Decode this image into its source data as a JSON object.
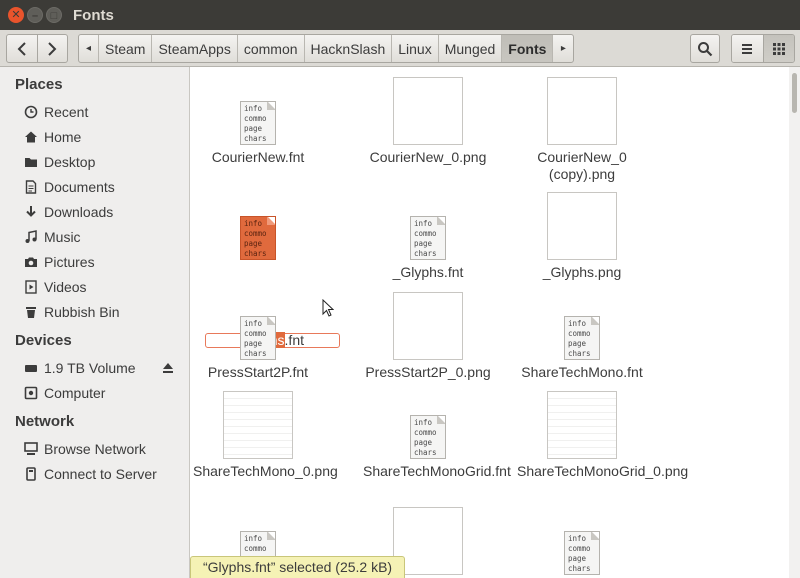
{
  "window": {
    "title": "Fonts"
  },
  "breadcrumbs": [
    {
      "label": "Steam"
    },
    {
      "label": "SteamApps"
    },
    {
      "label": "common"
    },
    {
      "label": "HacknSlash"
    },
    {
      "label": "Linux"
    },
    {
      "label": "Munged"
    },
    {
      "label": "Fonts",
      "active": true
    }
  ],
  "sidebar": {
    "places_heading": "Places",
    "places": [
      {
        "label": "Recent",
        "icon": "clock-icon"
      },
      {
        "label": "Home",
        "icon": "home-icon"
      },
      {
        "label": "Desktop",
        "icon": "folder-icon"
      },
      {
        "label": "Documents",
        "icon": "documents-icon"
      },
      {
        "label": "Downloads",
        "icon": "download-icon"
      },
      {
        "label": "Music",
        "icon": "music-icon"
      },
      {
        "label": "Pictures",
        "icon": "camera-icon"
      },
      {
        "label": "Videos",
        "icon": "video-icon"
      },
      {
        "label": "Rubbish Bin",
        "icon": "trash-icon"
      }
    ],
    "devices_heading": "Devices",
    "devices": [
      {
        "label": "1.9 TB Volume",
        "icon": "drive-icon"
      },
      {
        "label": "Computer",
        "icon": "computer-icon"
      }
    ],
    "network_heading": "Network",
    "network": [
      {
        "label": "Browse Network",
        "icon": "network-icon"
      },
      {
        "label": "Connect to Server",
        "icon": "server-icon"
      }
    ]
  },
  "doc_icon_lines": [
    "info",
    "commo",
    "page",
    "chars"
  ],
  "files": [
    {
      "name": "CourierNew.fnt",
      "type": "fnt"
    },
    {
      "name": "CourierNew_0.png",
      "type": "png"
    },
    {
      "name": "CourierNew_0 (copy).png",
      "type": "png"
    },
    {
      "name": "Glyphs.fnt",
      "type": "fnt",
      "selected": true
    },
    {
      "name": "_Glyphs.fnt",
      "type": "fnt"
    },
    {
      "name": "_Glyphs.png",
      "type": "png"
    },
    {
      "name": "PressStart2P.fnt",
      "type": "fnt"
    },
    {
      "name": "PressStart2P_0.png",
      "type": "png"
    },
    {
      "name": "ShareTechMono.fnt",
      "type": "fnt"
    },
    {
      "name": "ShareTechMono_0.png",
      "type": "png-dense"
    },
    {
      "name": "ShareTechMonoGrid.fnt",
      "type": "fnt"
    },
    {
      "name": "ShareTechMonoGrid_0.png",
      "type": "png-dense"
    },
    {
      "name": "",
      "type": "fnt"
    },
    {
      "name": "",
      "type": "png"
    },
    {
      "name": "",
      "type": "fnt"
    }
  ],
  "rename": {
    "selected_part": "Glyphs",
    "extension": ".fnt"
  },
  "status": {
    "text": "“Glyphs.fnt” selected  (25.2 kB)"
  },
  "colors": {
    "accent": "#e06a3d",
    "titlebar": "#3c3b37",
    "sidebar": "#efeeed",
    "toolbar": "#dcdad5"
  }
}
